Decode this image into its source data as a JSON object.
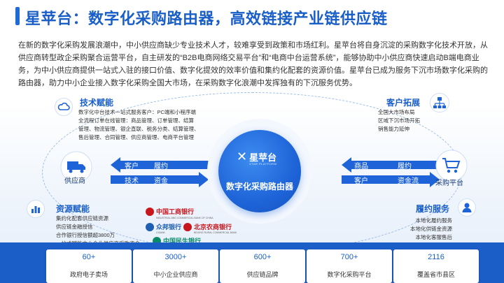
{
  "header": {
    "title": "星苹台：数字化采购路由器，高效链接产业链供应链"
  },
  "intro": {
    "text": "在新的数字化采购发展浪潮中，中小供应商缺少专业技术人才，较难享受到政策和市场红利。星苹台将自身沉淀的采购数字化技术开放，从供应商转型政企采购聚合运营平台，自主研发的“B2B电商网络交易平台”和“电商中台运营系统”，能够协助中小供应商快速启动B端电商业务，为中小供应商提供一站式入驻的接口价值、数字化提效的效率价值和集约化配套的资源价值。星苹台已成为服务下沉市场数字化采购的路由器，助力中小企业接入数字化采购全国大市场，在采购数字化浪潮中发挥独有的下沉服务优势。"
  },
  "tech": {
    "title": "技术赋能",
    "lines": [
      "数字化中台技术一站式服务客户：PC端和小程序端",
      "全流程订单在线管理：商品管理、订单管理、结算",
      "管理、物流管理、银企直联、税务分类、结算管理、",
      "售后管理、合同管理、供应商管理、电商平台管理"
    ]
  },
  "resource": {
    "title": "资源赋能",
    "lines": [
      "集约化配套供应链资源",
      "供应链金融授信",
      "合作银行授信额超3800万",
      "一站式赋能中小企业供应商采购资金"
    ]
  },
  "expand": {
    "title": "客户拓展",
    "lines": [
      "全国大市场布局",
      "区域下沉市场开拓",
      "销售能力延伸"
    ]
  },
  "service": {
    "title": "履约服务",
    "lines": [
      "本地化履约服务",
      "本地化供链金资源",
      "本地化客服售后"
    ]
  },
  "left_flow": {
    "top": [
      "客户",
      "履约"
    ],
    "bottom": [
      "技术",
      "资金"
    ],
    "node": "供应商"
  },
  "right_flow": {
    "top": [
      "商品",
      "履约"
    ],
    "bottom": [
      "客户",
      "资金流"
    ],
    "node": "采购平台"
  },
  "center": {
    "logo_name": "星苹台",
    "logo_sub": "XTAR PLATFORM",
    "label": "数字化采购路由器"
  },
  "banks": [
    {
      "name": "中国工商银行",
      "en": "INDUSTRIAL AND COMMERCIAL BANK OF CHINA",
      "color": "#c8161d"
    },
    {
      "name": "众邦银行",
      "en": "Z-BANK",
      "color": "#1e5fb4"
    },
    {
      "name": "北京农商银行",
      "en": "BEIJING RURAL COMMERCIAL BANK",
      "color": "#c8161d"
    },
    {
      "name": "中国民生银行",
      "en": "CHINA MINSHENG BANK",
      "color": "#0a8a6a"
    }
  ],
  "stats": [
    {
      "value": "60+",
      "label": "政府电子卖场"
    },
    {
      "value": "3000+",
      "label": "中小企业供应商"
    },
    {
      "value": "600+",
      "label": "供应链品牌"
    },
    {
      "value": "700+",
      "label": "数字化采购平台"
    },
    {
      "value": "2116",
      "label": "覆盖省市县区"
    }
  ],
  "colors": {
    "accent": "#1a5fc8",
    "arrow": "#1e64d8",
    "band": "#1b5ec8"
  },
  "icons": [
    "cloud-icon",
    "truck-icon",
    "bar-chart-icon",
    "org-chart-icon",
    "cart-icon",
    "service-person-icon"
  ]
}
